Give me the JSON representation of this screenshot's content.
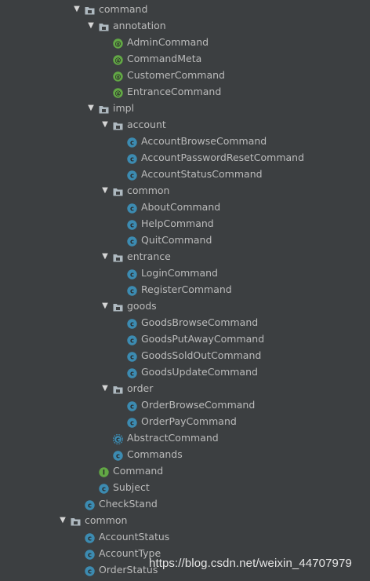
{
  "tree": [
    {
      "label": "command",
      "kind": "package",
      "depth": 0,
      "expanded": true
    },
    {
      "label": "annotation",
      "kind": "package",
      "depth": 1,
      "expanded": true
    },
    {
      "label": "AdminCommand",
      "kind": "annotation",
      "depth": 2
    },
    {
      "label": "CommandMeta",
      "kind": "annotation",
      "depth": 2
    },
    {
      "label": "CustomerCommand",
      "kind": "annotation",
      "depth": 2
    },
    {
      "label": "EntranceCommand",
      "kind": "annotation",
      "depth": 2
    },
    {
      "label": "impl",
      "kind": "package",
      "depth": 1,
      "expanded": true
    },
    {
      "label": "account",
      "kind": "package",
      "depth": 2,
      "expanded": true
    },
    {
      "label": "AccountBrowseCommand",
      "kind": "class",
      "depth": 3
    },
    {
      "label": "AccountPasswordResetCommand",
      "kind": "class",
      "depth": 3
    },
    {
      "label": "AccountStatusCommand",
      "kind": "class",
      "depth": 3
    },
    {
      "label": "common",
      "kind": "package",
      "depth": 2,
      "expanded": true
    },
    {
      "label": "AboutCommand",
      "kind": "class",
      "depth": 3
    },
    {
      "label": "HelpCommand",
      "kind": "class",
      "depth": 3
    },
    {
      "label": "QuitCommand",
      "kind": "class",
      "depth": 3
    },
    {
      "label": "entrance",
      "kind": "package",
      "depth": 2,
      "expanded": true
    },
    {
      "label": "LoginCommand",
      "kind": "class",
      "depth": 3
    },
    {
      "label": "RegisterCommand",
      "kind": "class",
      "depth": 3
    },
    {
      "label": "goods",
      "kind": "package",
      "depth": 2,
      "expanded": true
    },
    {
      "label": "GoodsBrowseCommand",
      "kind": "class",
      "depth": 3
    },
    {
      "label": "GoodsPutAwayCommand",
      "kind": "class",
      "depth": 3
    },
    {
      "label": "GoodsSoldOutCommand",
      "kind": "class",
      "depth": 3
    },
    {
      "label": "GoodsUpdateCommand",
      "kind": "class",
      "depth": 3
    },
    {
      "label": "order",
      "kind": "package",
      "depth": 2,
      "expanded": true
    },
    {
      "label": "OrderBrowseCommand",
      "kind": "class",
      "depth": 3
    },
    {
      "label": "OrderPayCommand",
      "kind": "class",
      "depth": 3
    },
    {
      "label": "AbstractCommand",
      "kind": "abstract-class",
      "depth": 2
    },
    {
      "label": "Commands",
      "kind": "class",
      "depth": 2
    },
    {
      "label": "Command",
      "kind": "interface",
      "depth": 1
    },
    {
      "label": "Subject",
      "kind": "class",
      "depth": 1
    },
    {
      "label": "CheckStand",
      "kind": "class",
      "depth": 0
    },
    {
      "label": "common",
      "kind": "package",
      "depth": -1,
      "expanded": true
    },
    {
      "label": "AccountStatus",
      "kind": "class",
      "depth": 0
    },
    {
      "label": "AccountType",
      "kind": "class",
      "depth": 0
    },
    {
      "label": "OrderStatus",
      "kind": "class",
      "depth": 0
    }
  ],
  "icons": {
    "package": "package-icon",
    "class": "class-icon",
    "abstract-class": "abstract-class-icon",
    "annotation": "annotation-icon",
    "interface": "interface-icon"
  },
  "colors": {
    "background": "#3c3f41",
    "text": "#bbbbbb",
    "class_icon": "#3c8bb1",
    "annotation_icon": "#62a845",
    "interface_icon": "#62a845",
    "package_icon": "#aeb9c0",
    "watermark": "#e6e6e6"
  },
  "watermark": "https://blog.csdn.net/weixin_44707979"
}
